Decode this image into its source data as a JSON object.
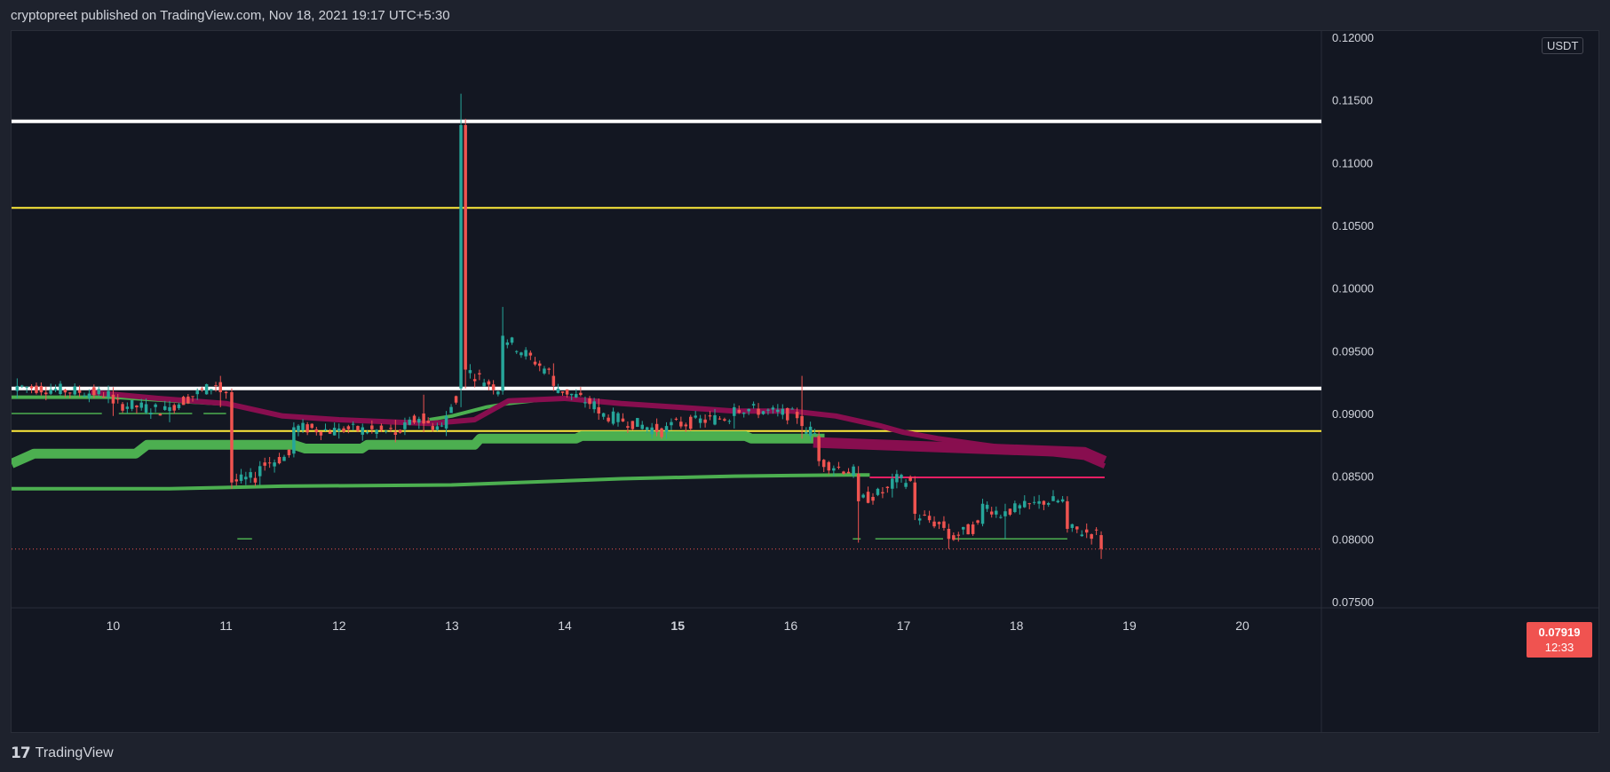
{
  "header": {
    "text": "cryptopreet published on TradingView.com, Nov 18, 2021 19:17 UTC+5:30"
  },
  "footer": {
    "logo_mark": "17",
    "brand": "TradingView"
  },
  "price_axis": {
    "unit": "USDT"
  },
  "last_price": {
    "value": "0.07919",
    "countdown": "12:33"
  },
  "colors": {
    "background": "#131722",
    "up_candle": "#26a69a",
    "down_candle": "#ef5350",
    "support_white": "#ffffff",
    "support_yellow": "#ffeb3b",
    "ribbon_green": "#4caf50",
    "ribbon_maroon": "#880e4f",
    "ribbon_pink": "#e91e63"
  },
  "chart_data": {
    "type": "candlestick",
    "title": "",
    "xlabel": "",
    "ylabel": "",
    "ylim": [
      0.0745,
      0.1205
    ],
    "xlim": [
      9.1,
      20.7
    ],
    "x_ticks": [
      {
        "value": 10,
        "label": "10"
      },
      {
        "value": 11,
        "label": "11"
      },
      {
        "value": 12,
        "label": "12"
      },
      {
        "value": 13,
        "label": "13"
      },
      {
        "value": 14,
        "label": "14"
      },
      {
        "value": 15,
        "label": "15",
        "bold": true
      },
      {
        "value": 16,
        "label": "16"
      },
      {
        "value": 17,
        "label": "17"
      },
      {
        "value": 18,
        "label": "18"
      },
      {
        "value": 19,
        "label": "19"
      },
      {
        "value": 20,
        "label": "20"
      }
    ],
    "y_ticks": [
      {
        "value": 0.12,
        "label": "0.12000"
      },
      {
        "value": 0.115,
        "label": "0.11500"
      },
      {
        "value": 0.11,
        "label": "0.11000"
      },
      {
        "value": 0.105,
        "label": "0.10500"
      },
      {
        "value": 0.1,
        "label": "0.10000"
      },
      {
        "value": 0.095,
        "label": "0.09500"
      },
      {
        "value": 0.09,
        "label": "0.09000"
      },
      {
        "value": 0.085,
        "label": "0.08500"
      },
      {
        "value": 0.08,
        "label": "0.08000"
      },
      {
        "value": 0.075,
        "label": "0.07500"
      }
    ],
    "horizontal_levels": [
      {
        "price": 0.1133,
        "color": "#ffffff",
        "width": 4
      },
      {
        "price": 0.1064,
        "color": "#ffeb3b",
        "width": 2
      },
      {
        "price": 0.092,
        "color": "#ffffff",
        "width": 4
      },
      {
        "price": 0.0886,
        "color": "#ffeb3b",
        "width": 2
      }
    ],
    "last_price_line": 0.07919,
    "anchor_candles": [
      {
        "t": 9.15,
        "o": 0.0918,
        "h": 0.0928,
        "l": 0.0912,
        "c": 0.0922
      },
      {
        "t": 10.0,
        "o": 0.0915,
        "h": 0.0921,
        "l": 0.0898,
        "c": 0.0908
      },
      {
        "t": 10.5,
        "o": 0.0902,
        "h": 0.091,
        "l": 0.0893,
        "c": 0.0905
      },
      {
        "t": 10.95,
        "o": 0.0925,
        "h": 0.093,
        "l": 0.0905,
        "c": 0.0917
      },
      {
        "t": 11.05,
        "o": 0.0917,
        "h": 0.092,
        "l": 0.084,
        "c": 0.0845
      },
      {
        "t": 11.3,
        "o": 0.085,
        "h": 0.0862,
        "l": 0.0843,
        "c": 0.0858
      },
      {
        "t": 11.6,
        "o": 0.0868,
        "h": 0.0893,
        "l": 0.0865,
        "c": 0.0889
      },
      {
        "t": 12.0,
        "o": 0.0886,
        "h": 0.0892,
        "l": 0.088,
        "c": 0.0888
      },
      {
        "t": 12.5,
        "o": 0.0885,
        "h": 0.0895,
        "l": 0.0877,
        "c": 0.0883
      },
      {
        "t": 12.75,
        "o": 0.09,
        "h": 0.0915,
        "l": 0.0885,
        "c": 0.0892
      },
      {
        "t": 12.95,
        "o": 0.0888,
        "h": 0.0902,
        "l": 0.0882,
        "c": 0.0898
      },
      {
        "t": 13.08,
        "o": 0.092,
        "h": 0.1155,
        "l": 0.0905,
        "c": 0.113
      },
      {
        "t": 13.12,
        "o": 0.113,
        "h": 0.1135,
        "l": 0.092,
        "c": 0.0935
      },
      {
        "t": 13.45,
        "o": 0.0918,
        "h": 0.0985,
        "l": 0.0915,
        "c": 0.0962
      },
      {
        "t": 13.9,
        "o": 0.093,
        "h": 0.094,
        "l": 0.0918,
        "c": 0.0922
      },
      {
        "t": 14.3,
        "o": 0.0905,
        "h": 0.0912,
        "l": 0.0895,
        "c": 0.09
      },
      {
        "t": 14.9,
        "o": 0.0885,
        "h": 0.0893,
        "l": 0.088,
        "c": 0.089
      },
      {
        "t": 15.5,
        "o": 0.0898,
        "h": 0.0908,
        "l": 0.0888,
        "c": 0.0905
      },
      {
        "t": 16.1,
        "o": 0.0898,
        "h": 0.093,
        "l": 0.088,
        "c": 0.089
      },
      {
        "t": 16.25,
        "o": 0.0882,
        "h": 0.0886,
        "l": 0.0858,
        "c": 0.0862
      },
      {
        "t": 16.6,
        "o": 0.0852,
        "h": 0.0858,
        "l": 0.0797,
        "c": 0.083
      },
      {
        "t": 16.9,
        "o": 0.084,
        "h": 0.0852,
        "l": 0.0833,
        "c": 0.0848
      },
      {
        "t": 17.1,
        "o": 0.0845,
        "h": 0.085,
        "l": 0.0815,
        "c": 0.082
      },
      {
        "t": 17.4,
        "o": 0.0808,
        "h": 0.0812,
        "l": 0.0792,
        "c": 0.08
      },
      {
        "t": 17.7,
        "o": 0.0812,
        "h": 0.0832,
        "l": 0.081,
        "c": 0.0828
      },
      {
        "t": 17.9,
        "o": 0.0818,
        "h": 0.0828,
        "l": 0.08,
        "c": 0.0822
      },
      {
        "t": 18.2,
        "o": 0.0828,
        "h": 0.0835,
        "l": 0.0824,
        "c": 0.083
      },
      {
        "t": 18.45,
        "o": 0.083,
        "h": 0.0834,
        "l": 0.0805,
        "c": 0.0808
      },
      {
        "t": 18.75,
        "o": 0.0803,
        "h": 0.0806,
        "l": 0.0784,
        "c": 0.0792
      }
    ],
    "ribbons": [
      {
        "name": "",
        "color": "#4caf50",
        "width": 11,
        "points": [
          [
            9.1,
            0.086
          ],
          [
            9.3,
            0.0868
          ],
          [
            10.2,
            0.0868
          ],
          [
            10.3,
            0.0875
          ],
          [
            11.6,
            0.0875
          ],
          [
            11.7,
            0.0872
          ],
          [
            12.2,
            0.0872
          ],
          [
            12.25,
            0.0875
          ],
          [
            13.2,
            0.0875
          ],
          [
            13.25,
            0.088
          ],
          [
            14.1,
            0.088
          ],
          [
            14.15,
            0.0882
          ],
          [
            15.6,
            0.0882
          ],
          [
            15.65,
            0.088
          ],
          [
            16.3,
            0.088
          ]
        ]
      },
      {
        "name": "",
        "color": "#4caf50",
        "width": 4,
        "points": [
          [
            9.1,
            0.084
          ],
          [
            10.5,
            0.084
          ],
          [
            11.5,
            0.0842
          ],
          [
            13.0,
            0.0843
          ],
          [
            14.5,
            0.0848
          ],
          [
            15.5,
            0.085
          ],
          [
            16.5,
            0.0851
          ],
          [
            16.7,
            0.0851
          ]
        ]
      },
      {
        "name": "",
        "color": "#4caf50",
        "width": 4,
        "points": [
          [
            9.1,
            0.0913
          ],
          [
            10.0,
            0.0913
          ],
          [
            10.9,
            0.0908
          ],
          [
            11.0,
            0.0908
          ]
        ]
      },
      {
        "name": "",
        "color": "#4caf50",
        "width": 4,
        "points": [
          [
            12.8,
            0.0895
          ],
          [
            13.0,
            0.0898
          ],
          [
            13.3,
            0.0905
          ],
          [
            13.5,
            0.0908
          ],
          [
            13.9,
            0.0912
          ],
          [
            14.05,
            0.0912
          ]
        ]
      },
      {
        "name": "",
        "color": "#880e4f",
        "width": 6,
        "points": [
          [
            9.8,
            0.0917
          ],
          [
            10.4,
            0.0912
          ],
          [
            11.0,
            0.0908
          ],
          [
            11.5,
            0.0898
          ],
          [
            12.0,
            0.0895
          ],
          [
            12.8,
            0.0892
          ],
          [
            13.2,
            0.0895
          ],
          [
            13.5,
            0.091
          ],
          [
            14.0,
            0.0912
          ],
          [
            14.5,
            0.0908
          ],
          [
            15.0,
            0.0905
          ],
          [
            15.5,
            0.0902
          ],
          [
            16.0,
            0.0902
          ],
          [
            16.4,
            0.0898
          ],
          [
            16.8,
            0.089
          ],
          [
            17.0,
            0.0885
          ],
          [
            17.3,
            0.088
          ],
          [
            17.7,
            0.0875
          ],
          [
            18.2,
            0.0869
          ],
          [
            18.6,
            0.0865
          ],
          [
            18.78,
            0.0858
          ]
        ]
      },
      {
        "name": "",
        "color": "#880e4f",
        "width": 12,
        "points": [
          [
            16.2,
            0.0877
          ],
          [
            18.6,
            0.0869
          ],
          [
            18.78,
            0.0862
          ]
        ]
      },
      {
        "name": "",
        "color": "#e91e63",
        "width": 2,
        "points": [
          [
            16.7,
            0.0849
          ],
          [
            18.78,
            0.0849
          ]
        ]
      }
    ],
    "thin_lines": [
      {
        "color": "#4caf50",
        "width": 1.5,
        "points": [
          [
            9.1,
            0.09
          ],
          [
            9.9,
            0.09
          ]
        ]
      },
      {
        "color": "#4caf50",
        "width": 1.5,
        "points": [
          [
            10.05,
            0.09
          ],
          [
            10.7,
            0.09
          ]
        ]
      },
      {
        "color": "#4caf50",
        "width": 1.5,
        "points": [
          [
            10.8,
            0.09
          ],
          [
            11.0,
            0.09
          ]
        ]
      },
      {
        "color": "#4caf50",
        "width": 1.5,
        "points": [
          [
            11.1,
            0.08
          ],
          [
            11.23,
            0.08
          ]
        ]
      },
      {
        "color": "#4caf50",
        "width": 1.5,
        "points": [
          [
            16.55,
            0.08
          ],
          [
            16.62,
            0.08
          ]
        ]
      },
      {
        "color": "#4caf50",
        "width": 1.5,
        "points": [
          [
            16.75,
            0.08
          ],
          [
            17.35,
            0.08
          ]
        ]
      },
      {
        "color": "#4caf50",
        "width": 1.5,
        "points": [
          [
            17.45,
            0.08
          ],
          [
            18.45,
            0.08
          ]
        ]
      }
    ]
  }
}
